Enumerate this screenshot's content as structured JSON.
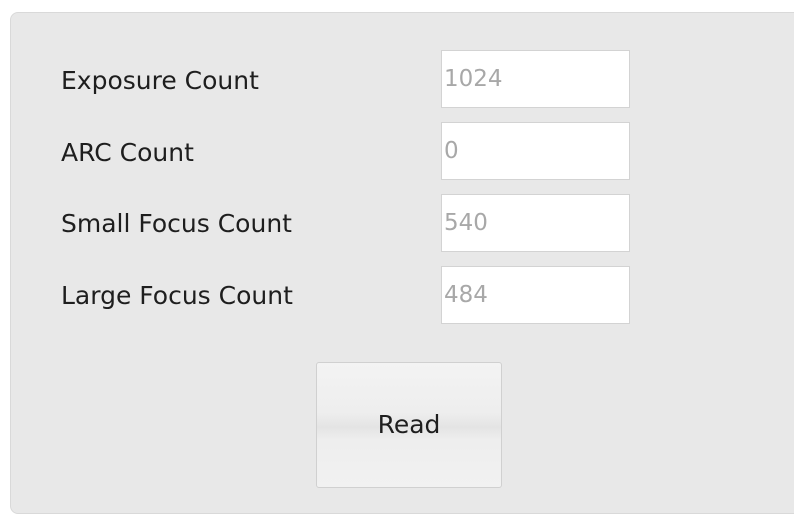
{
  "fields": [
    {
      "label": "Exposure Count",
      "value": "1024"
    },
    {
      "label": "ARC Count",
      "value": "0"
    },
    {
      "label": "Small Focus Count",
      "value": "540"
    },
    {
      "label": "Large Focus Count",
      "value": "484"
    }
  ],
  "read_button": {
    "label": "Read"
  }
}
